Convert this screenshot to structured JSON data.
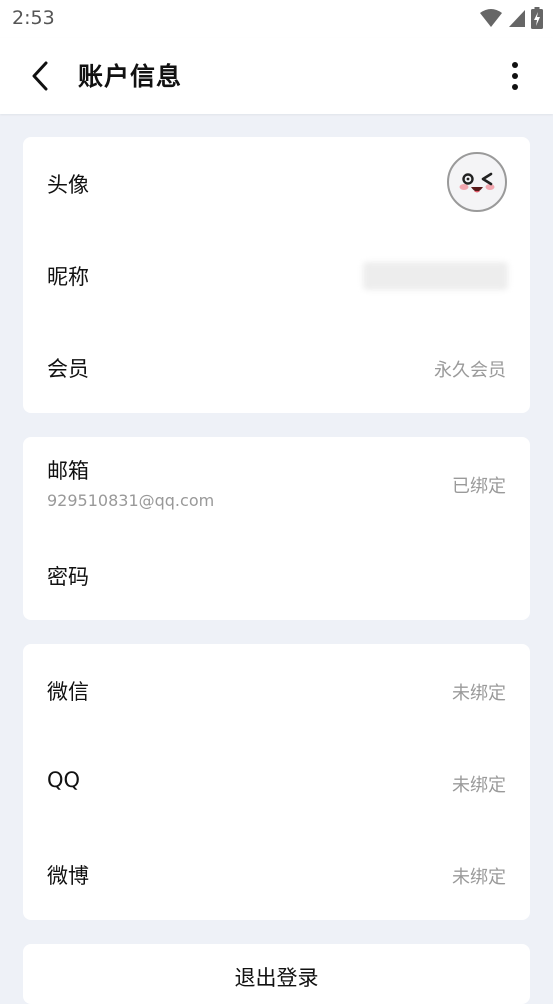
{
  "status_bar": {
    "time": "2:53"
  },
  "header": {
    "title": "账户信息"
  },
  "section_profile": {
    "avatar_label": "头像",
    "nickname_label": "昵称",
    "membership_label": "会员",
    "membership_value": "永久会员"
  },
  "section_account": {
    "email_label": "邮箱",
    "email_address": "929510831@qq.com",
    "email_status": "已绑定",
    "password_label": "密码"
  },
  "section_social": {
    "wechat_label": "微信",
    "wechat_status": "未绑定",
    "qq_label": "QQ",
    "qq_status": "未绑定",
    "weibo_label": "微博",
    "weibo_status": "未绑定"
  },
  "logout": {
    "label": "退出登录"
  },
  "colors": {
    "background": "#eef1f7",
    "card": "#ffffff",
    "muted_text": "#9a9a9a"
  },
  "icons": [
    "back-arrow-icon",
    "more-vertical-icon",
    "wifi-icon",
    "signal-icon",
    "battery-icon"
  ]
}
